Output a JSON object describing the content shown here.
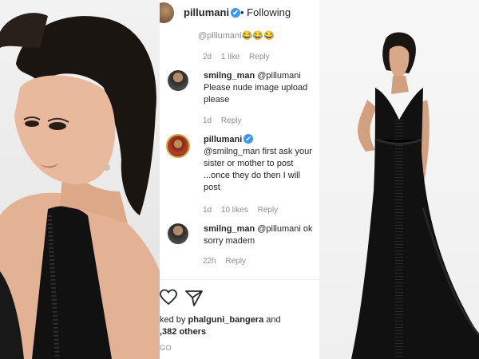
{
  "header": {
    "username": "pillumani",
    "verified_mark": "✔",
    "following_label": "• Following"
  },
  "previous_comment": {
    "text_fragment": "@pillumani😂😂😂",
    "time": "2d",
    "likes": "1 like",
    "reply_label": "Reply"
  },
  "comments": [
    {
      "username": "smilng_man",
      "text": " @pillumani Please nude image upload please",
      "time": "1d",
      "likes": "",
      "reply_label": "Reply"
    },
    {
      "username": "pillumani",
      "text": " @smilng_man first ask your sister or mother to post ...once they do then I will post",
      "time": "1d",
      "likes": "10 likes",
      "reply_label": "Reply"
    },
    {
      "username": "smilng_man",
      "text": " @pillumani ok sorry madem",
      "time": "22h",
      "likes": "",
      "reply_label": "Reply"
    }
  ],
  "footer": {
    "liked_prefix": "ked by ",
    "liked_user": "phalguni_bangera",
    "liked_and": " and",
    "others": ",382 others",
    "time_ago": "GO"
  },
  "icons": {
    "heart": "heart-icon",
    "send": "send-icon"
  },
  "colors": {
    "verified_blue": "#3897f0",
    "meta_grey": "#8e8e8e",
    "text": "#262626"
  }
}
